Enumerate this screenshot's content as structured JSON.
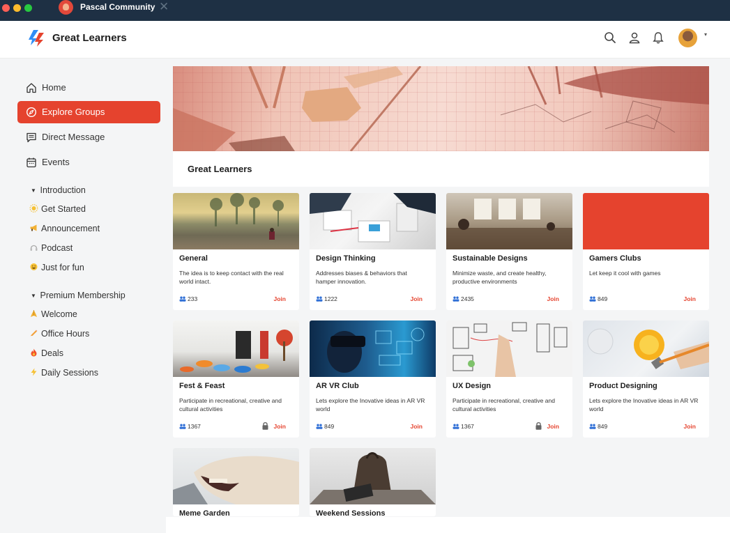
{
  "window": {
    "tab_title": "Pascal Community",
    "tab_close": "✕"
  },
  "header": {
    "brand": "Great Learners",
    "icons": [
      "search-icon",
      "user-icon",
      "bell-icon"
    ],
    "caret": "▾"
  },
  "sidebar": {
    "nav": [
      {
        "label": "Home",
        "icon": "home-icon"
      },
      {
        "label": "Explore Groups",
        "icon": "compass-icon",
        "active": true
      },
      {
        "label": "Direct Message",
        "icon": "message-icon"
      },
      {
        "label": "Events",
        "icon": "calendar-icon"
      }
    ],
    "sections": [
      {
        "title": "Introduction",
        "items": [
          {
            "label": "Get Started",
            "emoji": "🌞"
          },
          {
            "label": "Announcement",
            "emoji": "📣"
          },
          {
            "label": "Podcast",
            "emoji": "🎧"
          },
          {
            "label": "Just for fun",
            "emoji": "😀"
          }
        ]
      },
      {
        "title": "Premium Membership",
        "items": [
          {
            "label": "Welcome",
            "emoji": "🙏"
          },
          {
            "label": "Office Hours",
            "emoji": "✏️"
          },
          {
            "label": "Deals",
            "emoji": "🔥"
          },
          {
            "label": "Daily Sessions",
            "emoji": "⚡"
          }
        ]
      }
    ],
    "triangle": "▼"
  },
  "main": {
    "title": "Great Learners",
    "join_label": "Join",
    "cards": [
      {
        "title": "General",
        "desc": "The idea is to keep contact with the real world intact.",
        "members": "233",
        "locked": false
      },
      {
        "title": "Design Thinking",
        "desc": "Addresses biases & behaviors that hamper innovation.",
        "members": "1222",
        "locked": false
      },
      {
        "title": "Sustainable Designs",
        "desc": "Minimize waste, and create healthy, productive environments",
        "members": "2435",
        "locked": false
      },
      {
        "title": "Gamers Clubs",
        "desc": "Let keep it cool with games",
        "members": "849",
        "locked": false
      },
      {
        "title": "Fest & Feast",
        "desc": "Participate in recreational, creative and cultural activities",
        "members": "1367",
        "locked": true
      },
      {
        "title": "AR VR Club",
        "desc": "Lets explore the Inovative ideas in AR VR world",
        "members": "849",
        "locked": false
      },
      {
        "title": "UX Design",
        "desc": "Participate in recreational, creative and cultural activities",
        "members": "1367",
        "locked": true
      },
      {
        "title": "Product Designing",
        "desc": "Lets explore the Inovative ideas in AR VR world",
        "members": "849",
        "locked": false
      },
      {
        "title": "Meme Garden"
      },
      {
        "title": "Weekend Sessions"
      }
    ]
  },
  "colors": {
    "accent": "#e5432e",
    "chrome": "#1e3044",
    "background": "#f4f5f6"
  }
}
